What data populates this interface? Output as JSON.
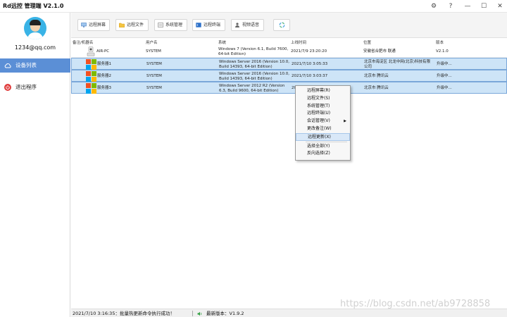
{
  "app": {
    "title": "Rd远控 管理端 V2.1.0"
  },
  "sidebar": {
    "email": "1234@qq.com",
    "items": [
      {
        "label": "设备列表"
      },
      {
        "label": "退出程序"
      }
    ]
  },
  "toolbar": {
    "buttons": [
      {
        "label": "远程屏幕"
      },
      {
        "label": "远程文件"
      },
      {
        "label": "系统管理"
      },
      {
        "label": "远程终端"
      },
      {
        "label": "视频语音"
      }
    ]
  },
  "table": {
    "columns": [
      "备注/机器名",
      "用户名",
      "系统",
      "上线时间",
      "位置",
      "版本"
    ],
    "rows": [
      {
        "name": "AIR-PC",
        "user": "SYSTEM",
        "os": "Windows 7 (Version 6.1, Build 7600,\n64-bit Edition)",
        "time": "2021/7/9 23:20:20",
        "loc": "安徽省合肥市 联通",
        "ver": "V2.1.0"
      },
      {
        "name": "服务器1",
        "user": "SYSTEM",
        "os": "Windows Server 2016 (Version 10.0,\nBuild 14393, 64-bit Edition)",
        "time": "2021/7/10 3:05:33",
        "loc": "北京市海淀区 北龙中网(北京)科技有限\n公司",
        "ver": "升级中..."
      },
      {
        "name": "服务器2",
        "user": "SYSTEM",
        "os": "Windows Server 2016 (Version 10.0,\nBuild 14393, 64-bit Edition)",
        "time": "2021/7/10 3:03:37",
        "loc": "北京市 腾讯云",
        "ver": "升级中..."
      },
      {
        "name": "服务器3",
        "user": "SYSTEM",
        "os": "Windows Server 2012 R2 (Version\n6.3, Build 9600, 64-bit Edition)",
        "time": "2021/7/10 3:0?:??",
        "loc": "北京市 腾讯云",
        "ver": "升级中..."
      }
    ]
  },
  "context_menu": {
    "items": [
      {
        "label": "远程屏幕(R)"
      },
      {
        "label": "远程文件(S)"
      },
      {
        "label": "系统管理(T)"
      },
      {
        "label": "远程终端(U)"
      },
      {
        "label": "会话管理(V)"
      },
      {
        "label": "更改备注(W)"
      },
      {
        "label": "远程更新(X)"
      },
      {
        "label": "选择全部(Y)"
      },
      {
        "label": "反向选择(Z)"
      }
    ]
  },
  "statusbar": {
    "message": "2021/7/10 3:16:35：批量热更新命令执行成功！",
    "version": "最新版本：V1.9.2"
  },
  "watermark": "https://blog.csdn.net/ab9728858",
  "colors": {
    "nav_active": "#5b8fd6",
    "row_selected": "#cde4f7",
    "accent_blue": "#39b3e6"
  }
}
